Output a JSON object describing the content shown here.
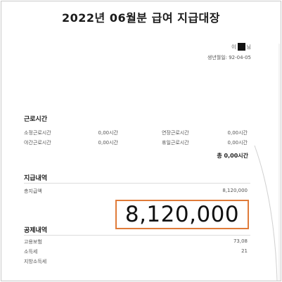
{
  "document": {
    "title": "2022년 06월분 급여 지급대장",
    "employee_name_prefix": "이",
    "employee_name_suffix": "님",
    "birth_label": "생년월일: 92-04-05"
  },
  "work_hours": {
    "heading": "근로시간",
    "items": [
      {
        "label": "소정근로시간",
        "value": "0,00시간"
      },
      {
        "label": "연장근로시간",
        "value": "0,00시간"
      },
      {
        "label": "야간근로시간",
        "value": "0,00시간"
      },
      {
        "label": "휴일근로시간",
        "value": "0,00시간"
      }
    ],
    "total": "총 0,00시간"
  },
  "payment": {
    "heading": "지급내역",
    "items": [
      {
        "label": "총지급액",
        "value": "8,120,000"
      }
    ]
  },
  "highlight_amount": "8,120,000",
  "deductions": {
    "heading": "공제내역",
    "items": [
      {
        "label": "고용보험",
        "value": "73,08"
      },
      {
        "label": "소득세",
        "value": "21"
      },
      {
        "label": "지방소득세",
        "value": ""
      }
    ]
  },
  "colors": {
    "highlight_border": "#e07b39",
    "redaction": "#111111"
  }
}
